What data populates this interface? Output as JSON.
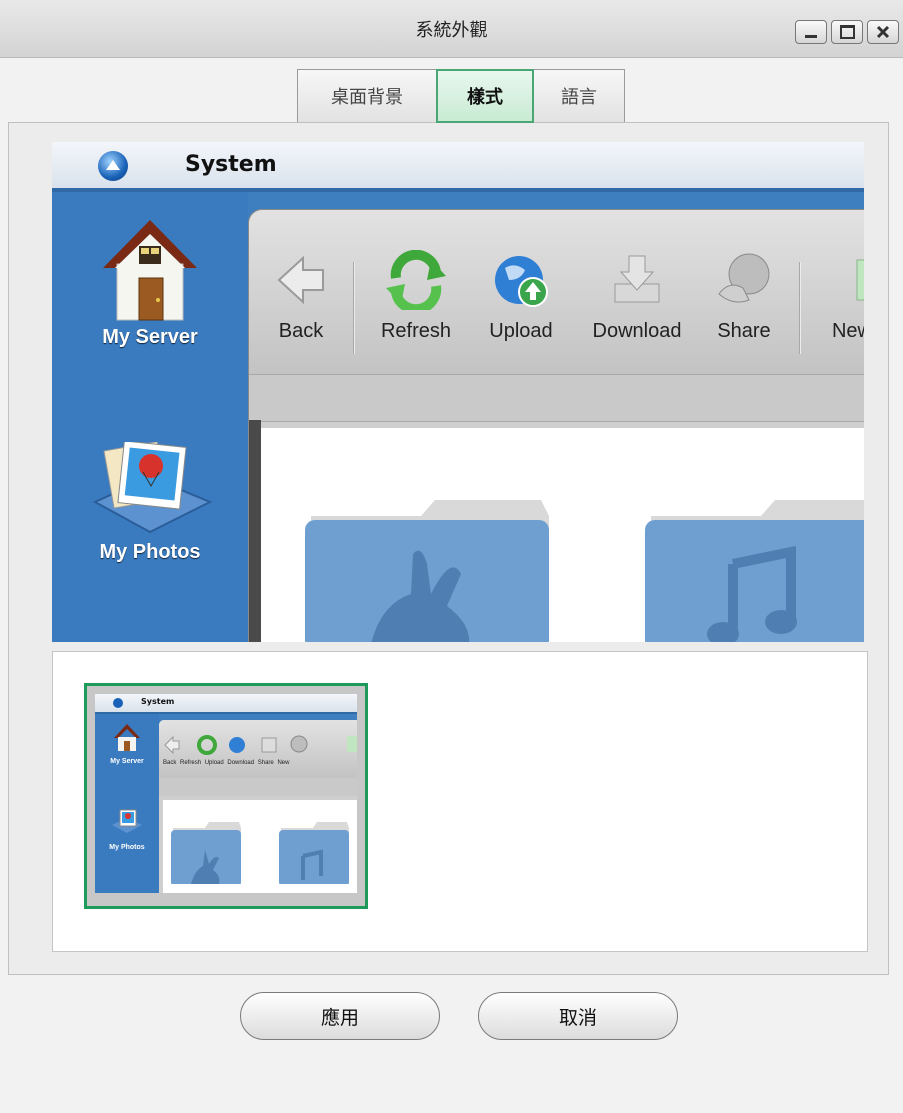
{
  "window": {
    "title": "系統外觀"
  },
  "tabs": [
    {
      "label": "桌面背景",
      "active": false
    },
    {
      "label": "樣式",
      "active": true
    },
    {
      "label": "語言",
      "active": false
    }
  ],
  "preview": {
    "app_title": "System",
    "sidebar": [
      {
        "label": "My Server",
        "icon": "house-icon"
      },
      {
        "label": "My Photos",
        "icon": "photos-icon"
      }
    ],
    "toolbar": [
      {
        "label": "Back",
        "icon": "back-arrow-icon"
      },
      {
        "label": "Refresh",
        "icon": "refresh-icon"
      },
      {
        "label": "Upload",
        "icon": "upload-globe-icon"
      },
      {
        "label": "Download",
        "icon": "download-icon"
      },
      {
        "label": "Share",
        "icon": "share-icon"
      },
      {
        "label": "New",
        "icon": "new-icon"
      }
    ],
    "folders": [
      {
        "icon": "rabbit-folder-icon"
      },
      {
        "icon": "music-folder-icon"
      }
    ]
  },
  "thumbnail": {
    "app_title": "System",
    "sidebar": [
      "My Server",
      "My Photos"
    ],
    "toolbar": [
      "Back",
      "Refresh",
      "Upload",
      "Download",
      "Share",
      "New"
    ],
    "selected": true
  },
  "buttons": {
    "apply": "應用",
    "cancel": "取消"
  },
  "colors": {
    "accent_green": "#1e9a5a",
    "preview_blue": "#3a7bc0"
  }
}
